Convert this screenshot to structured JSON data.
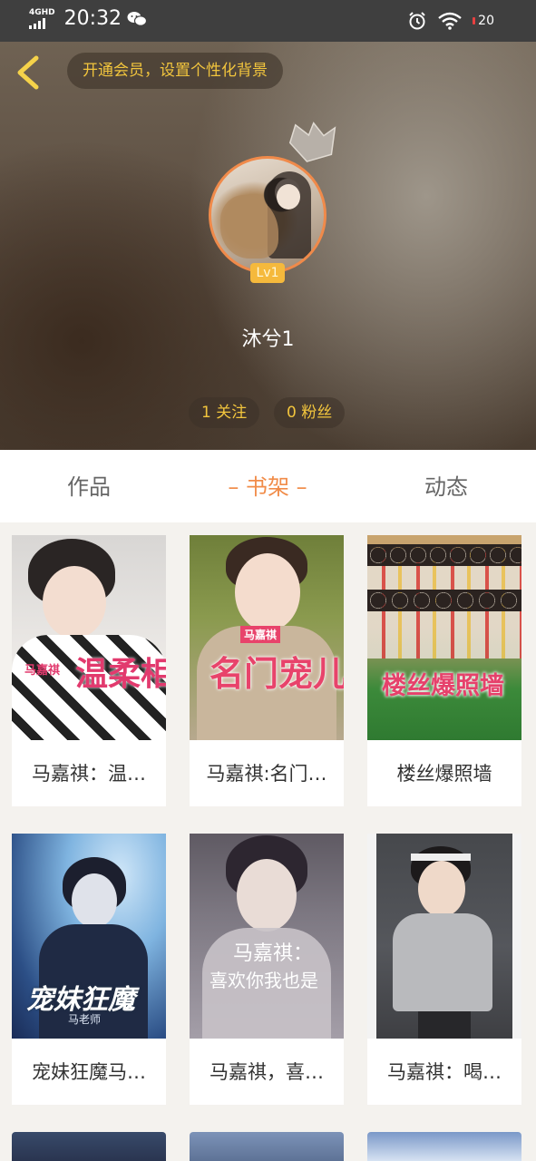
{
  "status_bar": {
    "network": "4GHD",
    "time": "20:32",
    "battery": "20"
  },
  "header": {
    "vip_prompt": "开通会员，设置个性化背景",
    "level": "Lv1",
    "username": "沐兮1",
    "following": "1 关注",
    "followers": "0 粉丝"
  },
  "tabs": [
    {
      "label": "作品",
      "active": false
    },
    {
      "label": "– 书架 –",
      "active": true
    },
    {
      "label": "动态",
      "active": false
    }
  ],
  "books": [
    {
      "title": "马嘉祺：温…",
      "cover_text": "温柔相待",
      "cover_sub": "马嘉祺"
    },
    {
      "title": "马嘉祺:名门…",
      "cover_text": "名门宠儿",
      "cover_sub": "马嘉祺"
    },
    {
      "title": "楼丝爆照墙",
      "cover_text": "楼丝爆照墙",
      "cover_sub": ""
    },
    {
      "title": "宠妹狂魔马…",
      "cover_text": "宠妹狂魔",
      "cover_sub": "马老师"
    },
    {
      "title": "马嘉祺，喜…",
      "cover_text": "马嘉祺：",
      "cover_sub": "喜欢你我也是"
    },
    {
      "title": "马嘉祺：喝…",
      "cover_text": "",
      "cover_sub": ""
    }
  ],
  "colors": {
    "accent": "#f18c49",
    "gold": "#f2c53d",
    "page_bg": "#f4f2ee"
  }
}
